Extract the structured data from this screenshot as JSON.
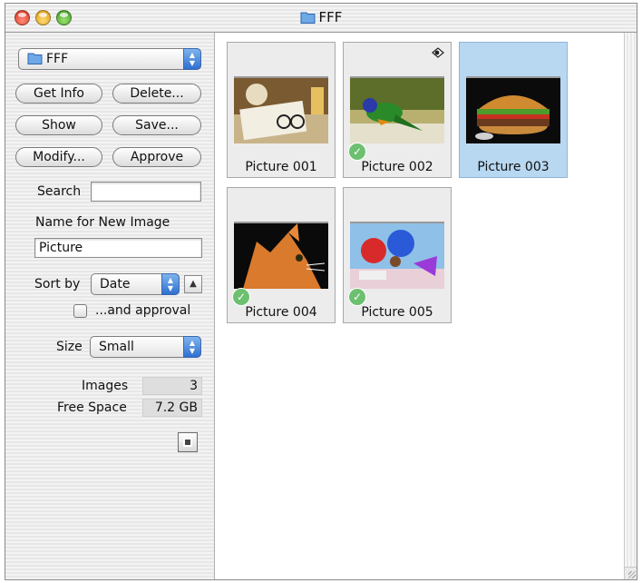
{
  "window": {
    "title": "FFF"
  },
  "sidebar": {
    "folder_popup": "FFF",
    "buttons": {
      "get_info": "Get Info",
      "delete": "Delete...",
      "show": "Show",
      "save": "Save...",
      "modify": "Modify...",
      "approve": "Approve"
    },
    "search_label": "Search",
    "search_value": "",
    "name_label": "Name for New Image",
    "name_value": "Picture",
    "sort_label": "Sort by",
    "sort_value": "Date",
    "approval_label": "...and approval",
    "approval_checked": false,
    "size_label": "Size",
    "size_value": "Small",
    "images_label": "Images",
    "images_value": "3",
    "free_space_label": "Free Space",
    "free_space_value": "7.2 GB"
  },
  "thumbnails": [
    {
      "name": "Picture 001",
      "approved": false,
      "selected": false
    },
    {
      "name": "Picture 002",
      "approved": true,
      "selected": false,
      "flag_icon": "eye-icon"
    },
    {
      "name": "Picture 003",
      "approved": false,
      "selected": true
    },
    {
      "name": "Picture 004",
      "approved": true,
      "selected": false
    },
    {
      "name": "Picture 005",
      "approved": true,
      "selected": false
    }
  ],
  "colors": {
    "selection": "#b8d8f2",
    "accent_popup": "#3a7bd5",
    "approved": "#6cc070"
  }
}
